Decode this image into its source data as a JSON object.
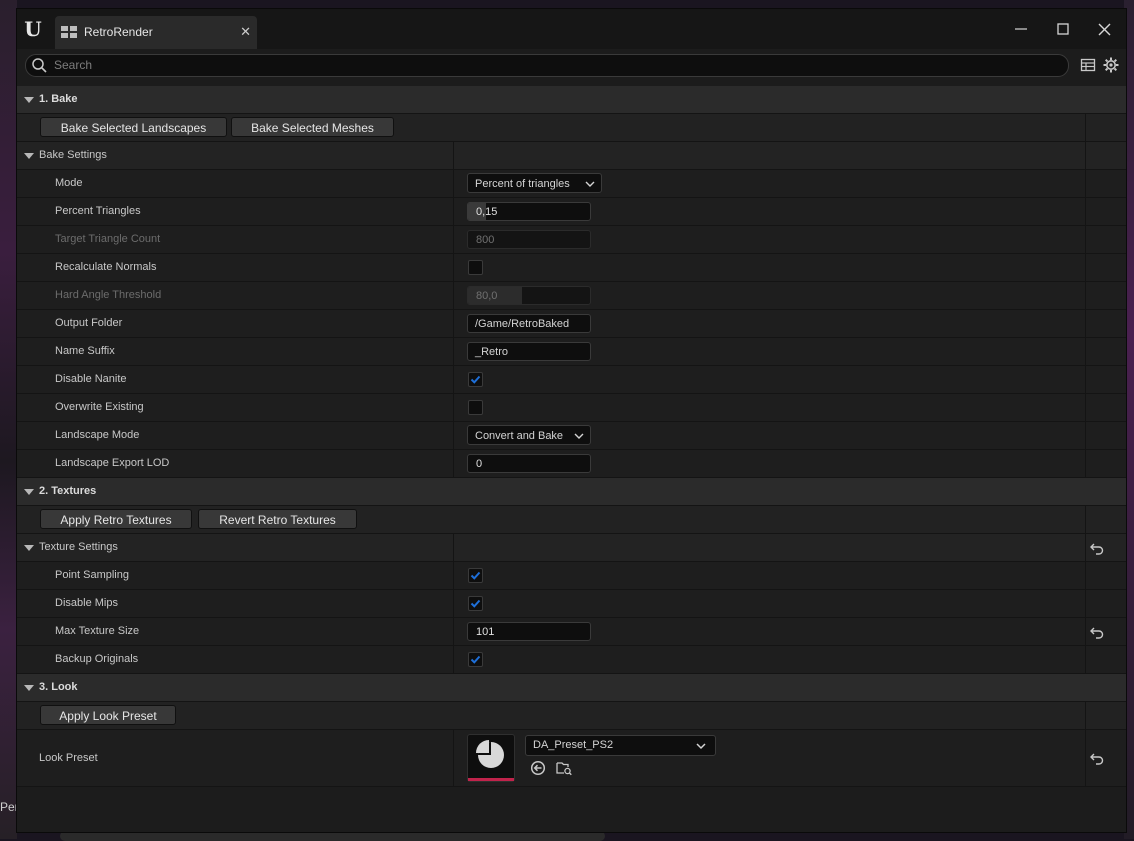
{
  "window": {
    "tab_title": "RetroRender"
  },
  "search": {
    "placeholder": "Search"
  },
  "sections": {
    "bake": {
      "header": "1. Bake",
      "buttons": [
        "Bake Selected Landscapes",
        "Bake Selected Meshes"
      ],
      "settings_header": "Bake Settings",
      "props": {
        "mode": {
          "label": "Mode",
          "value": "Percent of triangles"
        },
        "percent_triangles": {
          "label": "Percent Triangles",
          "value": "0,15",
          "fill_fraction": 0.15
        },
        "target_triangle_count": {
          "label": "Target Triangle Count",
          "value": "800"
        },
        "recalculate_normals": {
          "label": "Recalculate Normals",
          "checked": false
        },
        "hard_angle_threshold": {
          "label": "Hard Angle Threshold",
          "value": "80,0",
          "fill_fraction": 0.44
        },
        "output_folder": {
          "label": "Output Folder",
          "value": "/Game/RetroBaked"
        },
        "name_suffix": {
          "label": "Name Suffix",
          "value": "_Retro"
        },
        "disable_nanite": {
          "label": "Disable Nanite",
          "checked": true
        },
        "overwrite_existing": {
          "label": "Overwrite Existing",
          "checked": false
        },
        "landscape_mode": {
          "label": "Landscape Mode",
          "value": "Convert and Bake"
        },
        "landscape_export_lod": {
          "label": "Landscape Export LOD",
          "value": "0"
        }
      }
    },
    "textures": {
      "header": "2. Textures",
      "buttons": [
        "Apply Retro Textures",
        "Revert Retro Textures"
      ],
      "settings_header": "Texture Settings",
      "props": {
        "point_sampling": {
          "label": "Point Sampling",
          "checked": true
        },
        "disable_mips": {
          "label": "Disable Mips",
          "checked": true
        },
        "max_texture_size": {
          "label": "Max Texture Size",
          "value": "101"
        },
        "backup_originals": {
          "label": "Backup Originals",
          "checked": true
        }
      }
    },
    "look": {
      "header": "3. Look",
      "buttons": [
        "Apply Look Preset"
      ],
      "preset": {
        "label": "Look Preset",
        "value": "DA_Preset_PS2"
      }
    }
  },
  "background": {
    "left_text": "Per"
  },
  "colors": {
    "accent_check": "#1e6fd9",
    "thumb_bar": "#c1234b"
  }
}
